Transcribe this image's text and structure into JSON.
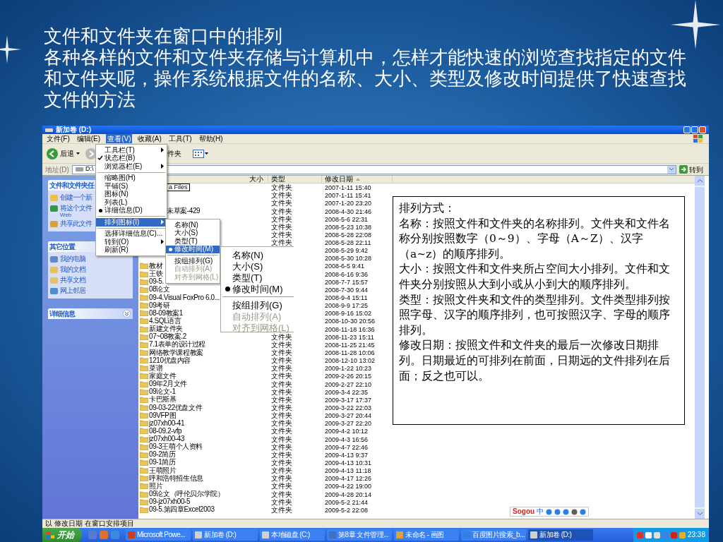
{
  "slide": {
    "heading": "文件和文件夹在窗口中的排列",
    "body": "各种各样的文件和文件夹存储与计算机中，怎样才能快速的浏览查找指定的文件和文件夹呢，操作系统根据文件的名称、大小、类型及修改时间提供了快速查找文件的方法"
  },
  "window": {
    "title": "新加卷 (D:)"
  },
  "menu_bar": [
    {
      "label": "文件(F)",
      "selected": false
    },
    {
      "label": "编辑(E)",
      "selected": false
    },
    {
      "label": "查看(V)",
      "selected": true
    },
    {
      "label": "收藏(A)",
      "selected": false
    },
    {
      "label": "工具(T)",
      "selected": false
    },
    {
      "label": "帮助(H)",
      "selected": false
    }
  ],
  "toolbar": {
    "back": "后退",
    "folders": "件夹"
  },
  "address_bar": {
    "label": "地址(D)",
    "value": "D:\\",
    "go": "转到"
  },
  "task_panes": [
    {
      "title": "文件和文件夹任",
      "items": [
        {
          "label": "创建一个新"
        },
        {
          "label": "将这个文件",
          "line2": "Web"
        },
        {
          "label": "共享此文件"
        }
      ]
    },
    {
      "title": "其它位置",
      "items": [
        {
          "label": "我的电脑"
        },
        {
          "label": "我的文档"
        },
        {
          "label": "共享文档"
        },
        {
          "label": "网上邻居"
        }
      ]
    },
    {
      "title": "详细信息"
    }
  ],
  "columns": [
    {
      "label": "大小",
      "sorted": false
    },
    {
      "label": "类型",
      "sorted": false
    },
    {
      "label": "修改日期",
      "sorted": true
    }
  ],
  "rows": [
    {
      "kind": "editing",
      "name": "a Files",
      "type": "文件夹",
      "date": "2007-1-11 15:40"
    },
    {
      "kind": "covered",
      "type": "文件夹",
      "date": "2007-1-11 15:41"
    },
    {
      "kind": "covered",
      "type": "文件夹",
      "date": "2007-1-20 23:20"
    },
    {
      "kind": "covered",
      "name": "未草案-429",
      "type": "文件夹",
      "date": "2008-4-30 21:46"
    },
    {
      "kind": "covered",
      "type": "文件夹",
      "date": "2008-5-6 22:31"
    },
    {
      "kind": "covered",
      "type": "文件夹",
      "date": "2008-5-23 10:38"
    },
    {
      "kind": "covered",
      "type": "文件夹",
      "date": "2008-5-28 22:08"
    },
    {
      "kind": "covered",
      "type": "文件夹",
      "date": "2008-5-28 22:11"
    },
    {
      "kind": "covered",
      "date": "2008-5-29 9:42"
    },
    {
      "kind": "covered",
      "date": "2008-5-30 10:28"
    },
    {
      "kind": "folder",
      "name": "教材",
      "date": "2008-6-5 9:41"
    },
    {
      "kind": "folder",
      "name": "王铁",
      "date": "2008-6-16 9:36"
    },
    {
      "kind": "folder",
      "name": "09-5.",
      "date": "2008-7-7 15:57"
    },
    {
      "kind": "folder",
      "name": "08论文",
      "date": "2008-7-30 9:44"
    },
    {
      "kind": "folder",
      "name": "09-4.Visual FoxPro 6.0...",
      "date": "2008-9-4 15:11"
    },
    {
      "kind": "folder",
      "name": "09考研",
      "date": "2008-9-9 17:25"
    },
    {
      "kind": "folder",
      "name": "08-09教案1",
      "date": "2008-9-16 15:02"
    },
    {
      "kind": "folder",
      "name": "4.SQL语言",
      "date": "2008-10-30 20:56"
    },
    {
      "kind": "folder",
      "name": "新建文件夹",
      "date": "2008-11-18 16:36"
    },
    {
      "kind": "folder",
      "name": "07~08教案.2",
      "type": "文件夹",
      "date": "2008-11-23 15:11"
    },
    {
      "kind": "folder",
      "name": "7.1表单的设计过程",
      "type": "文件夹",
      "date": "2008-11-25 21:45"
    },
    {
      "kind": "folder",
      "name": "网络教学课程教案",
      "type": "文件夹",
      "date": "2008-11-28 10:06"
    },
    {
      "kind": "folder",
      "name": "1210优盘内容",
      "type": "文件夹",
      "date": "2008-12-10 13:02"
    },
    {
      "kind": "folder",
      "name": "菜谱",
      "type": "文件夹",
      "date": "2009-1-22 10:23"
    },
    {
      "kind": "folder",
      "name": "家庭文件",
      "type": "文件夹",
      "date": "2009-2-26 20:15"
    },
    {
      "kind": "folder",
      "name": "09年2月文件",
      "type": "文件夹",
      "date": "2009-2-27 22:10"
    },
    {
      "kind": "folder",
      "name": "09论文-1",
      "type": "文件夹",
      "date": "2009-3-4 22:35"
    },
    {
      "kind": "folder",
      "name": "卡巴斯基",
      "type": "文件夹",
      "date": "2009-3-17 17:37"
    },
    {
      "kind": "folder",
      "name": "09-03-22优盘文件",
      "type": "文件夹",
      "date": "2009-3-22 22:03"
    },
    {
      "kind": "folder",
      "name": "09VFP图",
      "type": "文件夹",
      "date": "2009-3-27 20:44"
    },
    {
      "kind": "folder",
      "name": "jz07xh00-41",
      "type": "文件夹",
      "date": "2009-3-27 22:20"
    },
    {
      "kind": "folder",
      "name": "08-09.2-vfp",
      "type": "文件夹",
      "date": "2009-4-2 10:12"
    },
    {
      "kind": "folder",
      "name": "jz07xh00-43",
      "type": "文件夹",
      "date": "2009-4-3 16:56"
    },
    {
      "kind": "folder",
      "name": "09-3王萌个人资料",
      "type": "文件夹",
      "date": "2009-4-7 22:46"
    },
    {
      "kind": "folder",
      "name": "09-2简历",
      "type": "文件夹",
      "date": "2009-4-13 9:37"
    },
    {
      "kind": "folder",
      "name": "09-1简历",
      "type": "文件夹",
      "date": "2009-4-13 10:31"
    },
    {
      "kind": "folder",
      "name": "王萌照片",
      "type": "文件夹",
      "date": "2009-4-13 11:18"
    },
    {
      "kind": "folder",
      "name": "呼和浩特招生信息",
      "type": "文件夹",
      "date": "2009-4-17 12:26"
    },
    {
      "kind": "folder",
      "name": "照片",
      "type": "文件夹",
      "date": "2009-4-22 19:00"
    },
    {
      "kind": "folder",
      "name": "09论文（呼伦贝尔学院）",
      "type": "文件夹",
      "date": "2009-4-28 20:14"
    },
    {
      "kind": "folder",
      "name": "09-jz07xh00-5",
      "type": "文件夹",
      "date": "2009-5-2 21:44"
    },
    {
      "kind": "folder",
      "name": "09-5.第四章Excel2003",
      "type": "文件夹",
      "date": "2009-5-2 22:08"
    }
  ],
  "view_menu": [
    {
      "kind": "item",
      "label": "工具栏(T)",
      "submenu": true,
      "selected": false
    },
    {
      "kind": "check",
      "label": "状态栏(B)",
      "checked": true,
      "submenu": false,
      "selected": false
    },
    {
      "kind": "item",
      "label": "浏览器栏(E)",
      "submenu": true,
      "selected": false
    },
    {
      "kind": "separator"
    },
    {
      "kind": "radio",
      "label": "缩略图(H)",
      "checked": false,
      "submenu": false,
      "selected": false
    },
    {
      "kind": "radio",
      "label": "平铺(S)",
      "checked": false,
      "submenu": false,
      "selected": false
    },
    {
      "kind": "radio",
      "label": "图标(N)",
      "checked": false,
      "submenu": false,
      "selected": false
    },
    {
      "kind": "radio",
      "label": "列表(L)",
      "checked": false,
      "submenu": false,
      "selected": false
    },
    {
      "kind": "radio",
      "label": "详细信息(D)",
      "checked": true,
      "submenu": false,
      "selected": false
    },
    {
      "kind": "separator"
    },
    {
      "kind": "item",
      "label": "排列图标(I)",
      "submenu": true,
      "selected": true
    },
    {
      "kind": "separator"
    },
    {
      "kind": "item",
      "label": "选择详细信息(C)...",
      "submenu": false,
      "selected": false
    },
    {
      "kind": "item",
      "label": "转到(O)",
      "submenu": true,
      "selected": false
    },
    {
      "kind": "item",
      "label": "刷新(R)",
      "submenu": false,
      "selected": false
    }
  ],
  "arrange_menu": [
    {
      "kind": "radio",
      "label": "名称(N)",
      "checked": false,
      "disabled": false,
      "selected": false
    },
    {
      "kind": "radio",
      "label": "大小(S)",
      "checked": false,
      "disabled": false,
      "selected": false
    },
    {
      "kind": "radio",
      "label": "类型(T)",
      "checked": false,
      "disabled": false,
      "selected": false
    },
    {
      "kind": "radio",
      "label": "修改时间(M)",
      "checked": true,
      "disabled": false,
      "selected": true
    },
    {
      "kind": "separator"
    },
    {
      "kind": "item",
      "label": "按组排列(G)",
      "disabled": false,
      "selected": false
    },
    {
      "kind": "item",
      "label": "自动排列(A)",
      "disabled": true,
      "selected": false
    },
    {
      "kind": "item",
      "label": "对齐到网格(L)",
      "disabled": true,
      "selected": false
    }
  ],
  "enlarged_menu": [
    {
      "kind": "radio",
      "label": "名称(N)",
      "checked": false,
      "disabled": false
    },
    {
      "kind": "radio",
      "label": "大小(S)",
      "checked": false,
      "disabled": false
    },
    {
      "kind": "radio",
      "label": "类型(T)",
      "checked": false,
      "disabled": false
    },
    {
      "kind": "radio",
      "label": "修改时间(M)",
      "checked": true,
      "disabled": false
    },
    {
      "kind": "separator"
    },
    {
      "kind": "item",
      "label": "按组排列(G)",
      "disabled": false
    },
    {
      "kind": "item",
      "label": "自动排列(A)",
      "disabled": true
    },
    {
      "kind": "item",
      "label": "对齐到网格(L)",
      "disabled": true
    }
  ],
  "status_bar": "以 修改日期 在窗口安排项目",
  "ime_bar": {
    "logo": "Sogou",
    "mode": "中"
  },
  "taskbar": {
    "start": "开始",
    "tasks": [
      {
        "label": "Microsoft Powe...",
        "selected": false
      },
      {
        "label": "新加卷 (D:)",
        "selected": false
      },
      {
        "label": "本地磁盘 (C:)",
        "selected": false
      },
      {
        "label": "第8章 文件管理...",
        "selected": false
      },
      {
        "label": "未命名 - 画图",
        "selected": false
      },
      {
        "label": "百度图片搜索_b...",
        "selected": false
      },
      {
        "label": "新加卷 (D:)",
        "selected": true
      }
    ],
    "clock": "23:38"
  },
  "note_box": {
    "heading": "排列方式：",
    "paragraphs": [
      "名称：按照文件和文件夹的名称排列。文件夹和文件名称分别按照数字（0～9）、字母（A～Z）、汉字（a~z）的顺序排列。",
      "大小：按照文件和文件夹所占空间大小排列。文件和文件夹分别按照从大到小或从小到大的顺序排列。",
      "类型：按照文件夹和文件的类型排列。文件类型排列按照字母、汉字的顺序排列，也可按照汉字、字母的顺序排列。",
      "修改日期：按照文件和文件夹的最后一次修改日期排列。日期最近的可排列在前面，日期远的文件排列在后面；反之也可以。"
    ]
  }
}
